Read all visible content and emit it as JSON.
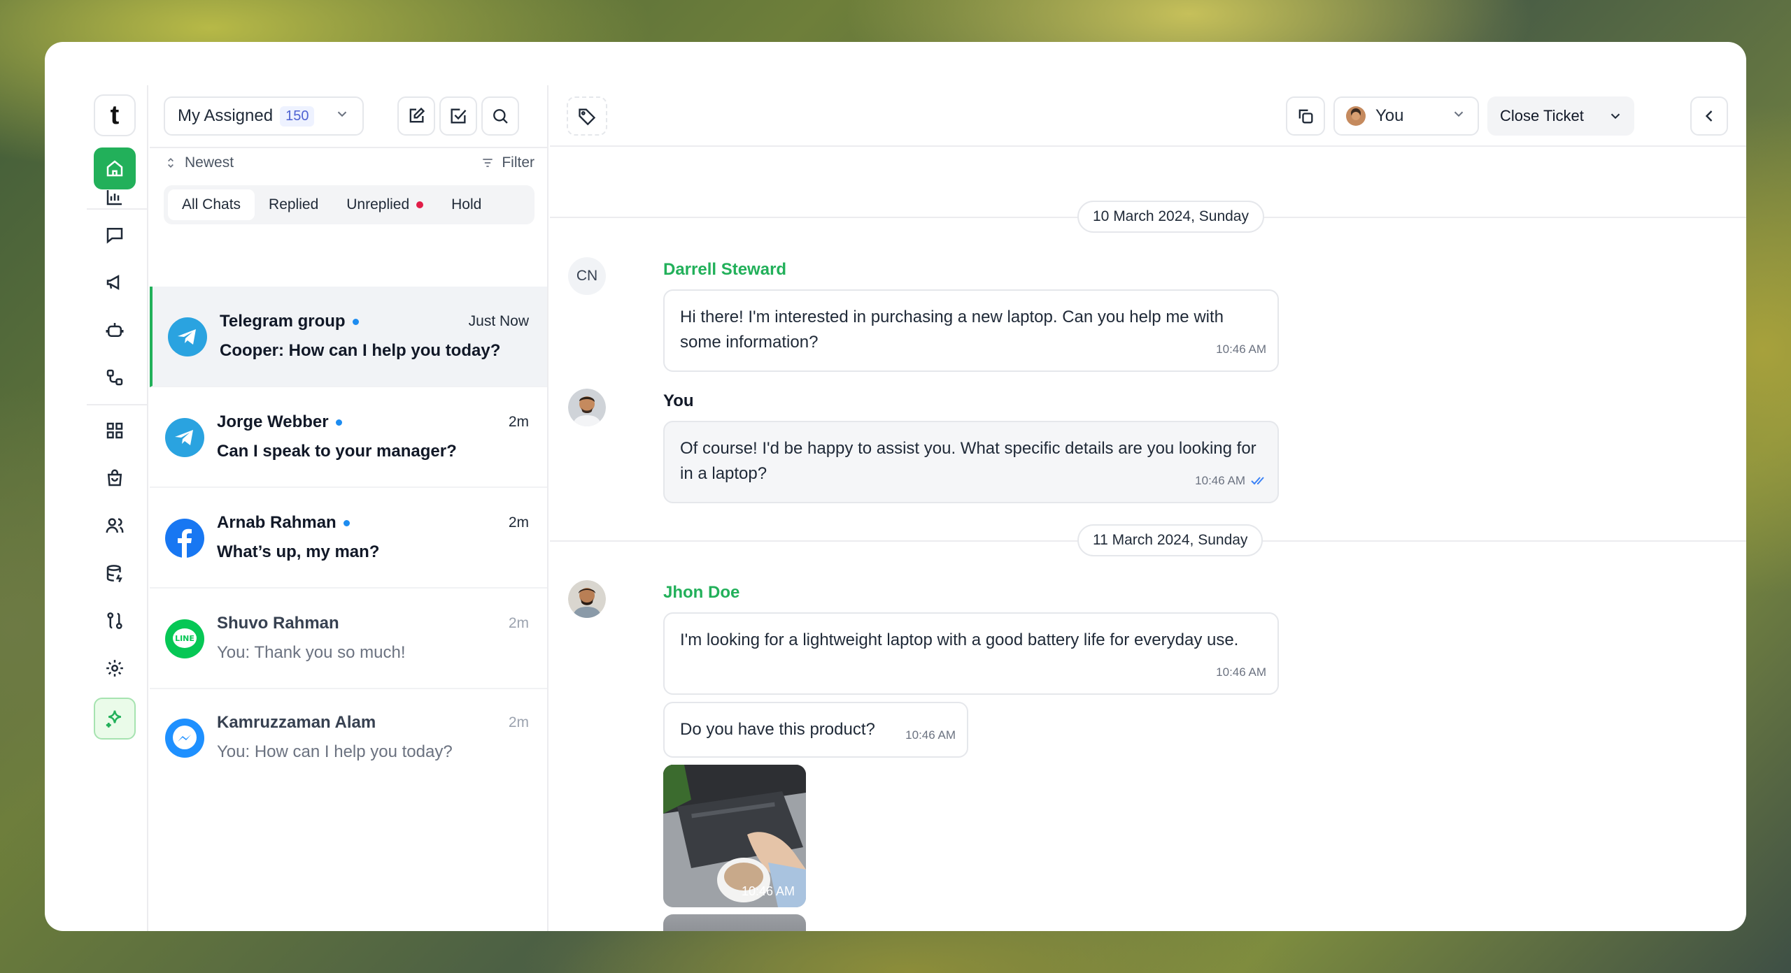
{
  "rail": {
    "logo": "t",
    "items": [
      {
        "icon": "home-icon",
        "active": true
      },
      {
        "icon": "bar-chart-icon"
      },
      {
        "icon": "chat-bubble-icon"
      },
      {
        "icon": "megaphone-icon"
      },
      {
        "icon": "bot-icon"
      },
      {
        "icon": "workflow-icon"
      },
      {
        "icon": "grid-icon"
      },
      {
        "icon": "shopping-bag-icon"
      },
      {
        "icon": "users-icon"
      },
      {
        "icon": "database-icon"
      },
      {
        "icon": "routing-icon"
      },
      {
        "icon": "gear-icon"
      },
      {
        "icon": "sparkle-icon"
      }
    ]
  },
  "list": {
    "assign_label": "My Assigned",
    "assign_count": "150",
    "sort_label": "Newest",
    "filter_label": "Filter",
    "tabs": [
      {
        "label": "All Chats"
      },
      {
        "label": "Replied"
      },
      {
        "label": "Unreplied"
      },
      {
        "label": "Hold"
      }
    ],
    "conversations": [
      {
        "name": "Telegram group",
        "message": "Cooper: How can I help you today?",
        "time": "Just Now",
        "channel": "telegram",
        "unread": true
      },
      {
        "name": "Jorge Webber",
        "message": "Can I speak to your manager?",
        "time": "2m",
        "channel": "telegram",
        "unread": true
      },
      {
        "name": "Arnab Rahman",
        "message": "What’s up, my man?",
        "time": "2m",
        "channel": "facebook",
        "unread": true
      },
      {
        "name": "Shuvo Rahman",
        "message": "You: Thank you so much!",
        "time": "2m",
        "channel": "line",
        "unread": false
      },
      {
        "name": "Kamruzzaman Alam",
        "message": "You: How can I help you today?",
        "time": "2m",
        "channel": "messenger",
        "unread": false
      }
    ]
  },
  "header": {
    "assignee": "You",
    "close_ticket": "Close Ticket"
  },
  "chat": {
    "dates": [
      "10 March 2024, Sunday",
      "11 March 2024, Sunday"
    ],
    "messages": [
      {
        "sender": "Darrell Steward",
        "initials": "CN",
        "text": "Hi there! I'm interested in purchasing a new laptop. Can you help me with some information?",
        "time": "10:46 AM"
      },
      {
        "sender": "You",
        "text": "Of course! I'd be happy to assist you. What specific details are you looking for in a laptop?",
        "time": "10:46 AM"
      },
      {
        "sender": "Jhon Doe",
        "text": "I'm looking for a lightweight laptop with a good battery life for everyday use.",
        "time": "10:46 AM"
      },
      {
        "text": "Do you have this product?",
        "time": "10:46 AM"
      },
      {
        "image": "laptop-photo",
        "time": "10:46 AM"
      }
    ]
  },
  "colors": {
    "accent": "#22b05a",
    "telegram": "#2aa3e0",
    "facebook": "#1877f2",
    "line": "#06c755",
    "messenger": "#1e90ff"
  }
}
